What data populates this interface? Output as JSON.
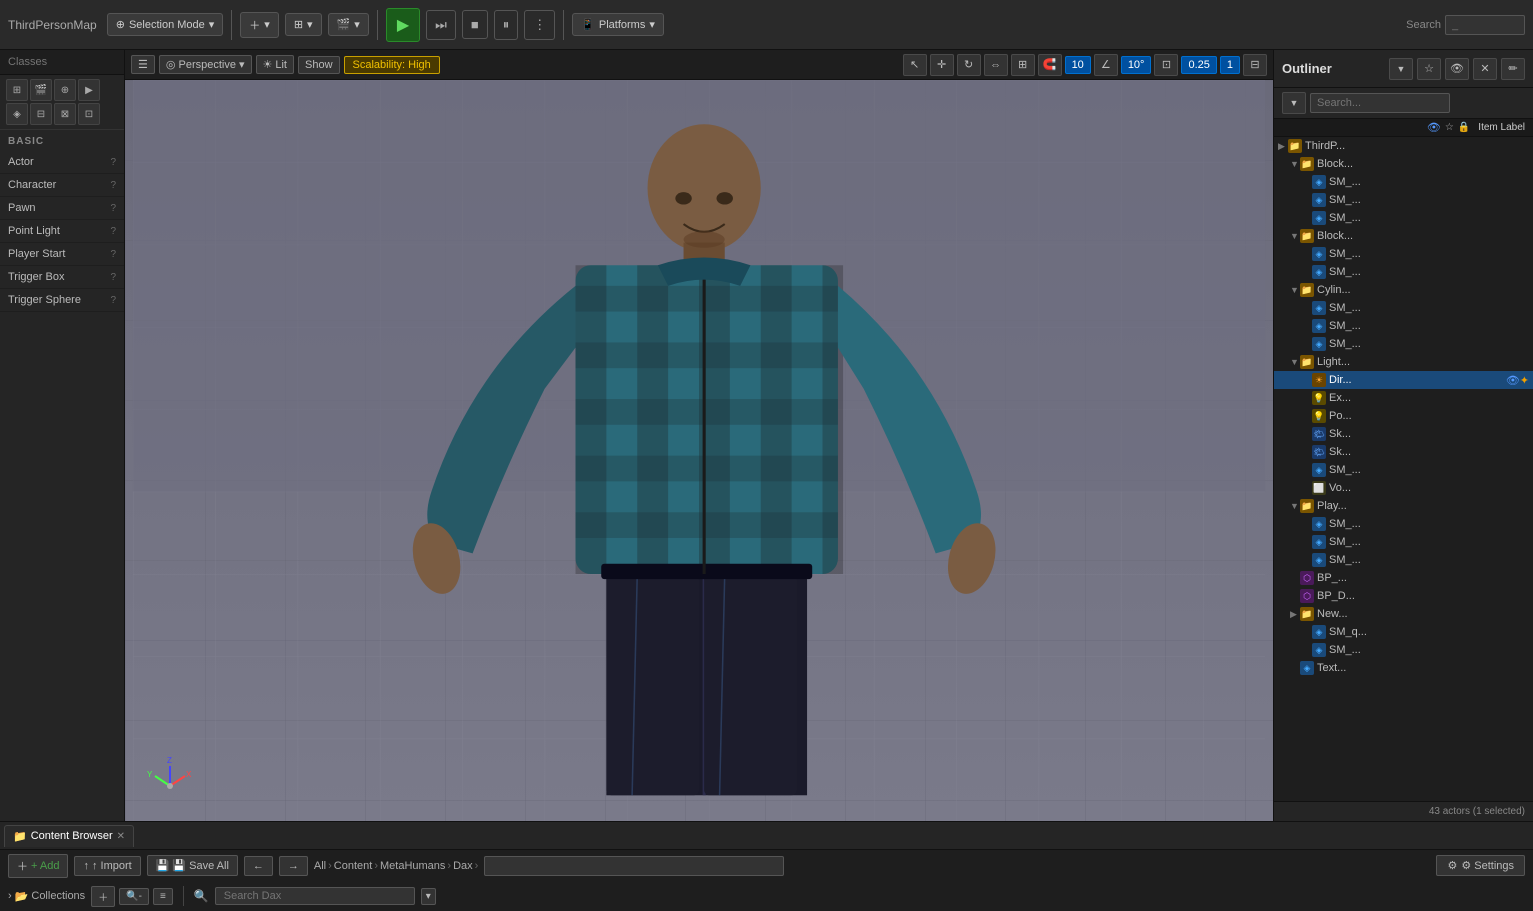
{
  "app": {
    "title": "ThirdPersonMap"
  },
  "topbar": {
    "selection_mode_label": "Selection Mode",
    "platforms_label": "Platforms",
    "play_icon": "▶",
    "step_icon": "⏭",
    "stop_icon": "■",
    "pause_icon": "⏸",
    "more_icon": "⋮"
  },
  "viewport": {
    "perspective_label": "Perspective",
    "lit_label": "Lit",
    "show_label": "Show",
    "scalability_label": "Scalability: High",
    "grid_value": "10",
    "angle_value": "10°",
    "scale_value": "0.25",
    "num_value": "1"
  },
  "left_panel": {
    "search_placeholder": "Classes",
    "section_title": "BASIC",
    "items": [
      {
        "label": "Actor",
        "id": "actor"
      },
      {
        "label": "Character",
        "id": "character"
      },
      {
        "label": "Pawn",
        "id": "pawn"
      },
      {
        "label": "Point Light",
        "id": "point-light"
      },
      {
        "label": "Player Start",
        "id": "player-start"
      },
      {
        "label": "Trigger Box",
        "id": "trigger-box"
      },
      {
        "label": "Trigger Sphere",
        "id": "trigger-sphere"
      }
    ]
  },
  "outliner": {
    "title": "Outliner",
    "search_placeholder": "Search...",
    "col_label": "Item Label",
    "items": [
      {
        "indent": 0,
        "label": "ThirdP...",
        "type": "folder",
        "id": "thirdp"
      },
      {
        "indent": 1,
        "label": "Block...",
        "type": "folder",
        "id": "block1",
        "arrow": "▼"
      },
      {
        "indent": 2,
        "label": "SM_...",
        "type": "mesh",
        "id": "sm1"
      },
      {
        "indent": 2,
        "label": "SM_...",
        "type": "mesh",
        "id": "sm2"
      },
      {
        "indent": 2,
        "label": "SM_...",
        "type": "mesh",
        "id": "sm3"
      },
      {
        "indent": 1,
        "label": "Block...",
        "type": "folder",
        "id": "block2",
        "arrow": "▼"
      },
      {
        "indent": 2,
        "label": "SM_...",
        "type": "mesh",
        "id": "sm4"
      },
      {
        "indent": 2,
        "label": "SM_...",
        "type": "mesh",
        "id": "sm5"
      },
      {
        "indent": 1,
        "label": "Cylin...",
        "type": "folder",
        "id": "cylin",
        "arrow": "▼"
      },
      {
        "indent": 2,
        "label": "SM_...",
        "type": "mesh",
        "id": "sm6"
      },
      {
        "indent": 2,
        "label": "SM_...",
        "type": "mesh",
        "id": "sm7"
      },
      {
        "indent": 2,
        "label": "SM_...",
        "type": "mesh",
        "id": "sm8"
      },
      {
        "indent": 1,
        "label": "Light...",
        "type": "folder",
        "id": "light-folder",
        "arrow": "▼"
      },
      {
        "indent": 2,
        "label": "Dir...",
        "type": "directional",
        "id": "dir-light",
        "selected": true
      },
      {
        "indent": 2,
        "label": "Ex...",
        "type": "light",
        "id": "ex-light"
      },
      {
        "indent": 2,
        "label": "Po...",
        "type": "light",
        "id": "po-light"
      },
      {
        "indent": 2,
        "label": "Sk...",
        "type": "sky",
        "id": "sky1"
      },
      {
        "indent": 2,
        "label": "Sk...",
        "type": "sky",
        "id": "sky2"
      },
      {
        "indent": 2,
        "label": "SM_...",
        "type": "mesh",
        "id": "sm9"
      },
      {
        "indent": 2,
        "label": "Vo...",
        "type": "volume",
        "id": "vo1"
      },
      {
        "indent": 1,
        "label": "Play...",
        "type": "folder",
        "id": "play-folder",
        "arrow": "▼"
      },
      {
        "indent": 2,
        "label": "SM_...",
        "type": "mesh",
        "id": "sm10"
      },
      {
        "indent": 2,
        "label": "SM_...",
        "type": "mesh",
        "id": "sm11"
      },
      {
        "indent": 2,
        "label": "SM_...",
        "type": "mesh",
        "id": "sm12"
      },
      {
        "indent": 1,
        "label": "BP_...",
        "type": "bp",
        "id": "bp1"
      },
      {
        "indent": 1,
        "label": "BP_D...",
        "type": "bp",
        "id": "bp2"
      },
      {
        "indent": 1,
        "label": "New...",
        "type": "folder",
        "id": "new-folder"
      },
      {
        "indent": 2,
        "label": "SM_q...",
        "type": "mesh",
        "id": "sm13"
      },
      {
        "indent": 2,
        "label": "SM_...",
        "type": "mesh",
        "id": "sm14"
      },
      {
        "indent": 1,
        "label": "Text...",
        "type": "mesh",
        "id": "text1"
      }
    ],
    "status": "43 actors (1 selected)"
  },
  "content_browser": {
    "tab_label": "Content Browser",
    "add_label": "+ Add",
    "import_label": "↑ Import",
    "save_all_label": "💾 Save All",
    "all_label": "All",
    "content_label": "Content",
    "metahumans_label": "MetaHumans",
    "dax_label": "Dax",
    "settings_label": "⚙ Settings",
    "collections_label": "Collections",
    "search_placeholder": "Search Dax"
  }
}
